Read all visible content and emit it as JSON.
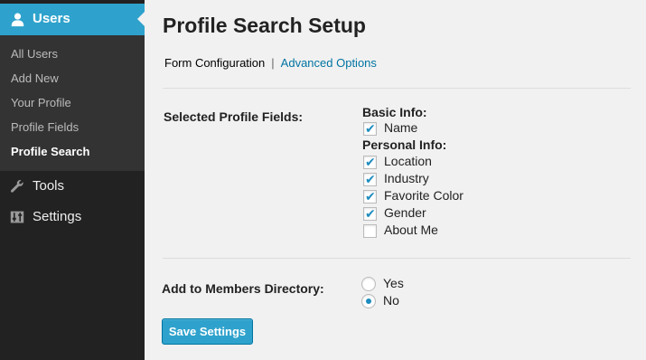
{
  "sidebar": {
    "active_menu": {
      "label": "Users",
      "icon": "user-icon"
    },
    "submenu": [
      {
        "label": "All Users",
        "current": false
      },
      {
        "label": "Add New",
        "current": false
      },
      {
        "label": "Your Profile",
        "current": false
      },
      {
        "label": "Profile Fields",
        "current": false
      },
      {
        "label": "Profile Search",
        "current": true
      }
    ],
    "menu": [
      {
        "label": "Tools",
        "icon": "wrench-icon"
      },
      {
        "label": "Settings",
        "icon": "settings-sliders-icon"
      }
    ]
  },
  "page": {
    "title": "Profile Search Setup",
    "subnav": {
      "current": "Form Configuration",
      "separator": "|",
      "link": "Advanced Options"
    }
  },
  "form": {
    "selected_fields_label": "Selected Profile Fields:",
    "groups": [
      {
        "label": "Basic Info:",
        "fields": [
          {
            "label": "Name",
            "checked": true
          }
        ]
      },
      {
        "label": "Personal Info:",
        "fields": [
          {
            "label": "Location",
            "checked": true
          },
          {
            "label": "Industry",
            "checked": true
          },
          {
            "label": "Favorite Color",
            "checked": true
          },
          {
            "label": "Gender",
            "checked": true
          },
          {
            "label": "About Me",
            "checked": false
          }
        ]
      }
    ],
    "directory_label": "Add to Members Directory:",
    "directory_options": [
      {
        "label": "Yes",
        "selected": false
      },
      {
        "label": "No",
        "selected": true
      }
    ],
    "save_label": "Save Settings"
  },
  "colors": {
    "accent": "#2ea2cc",
    "sidebar_bg": "#222222",
    "submenu_bg": "#333333",
    "link": "#0074a2",
    "check": "#1e8cbe"
  }
}
